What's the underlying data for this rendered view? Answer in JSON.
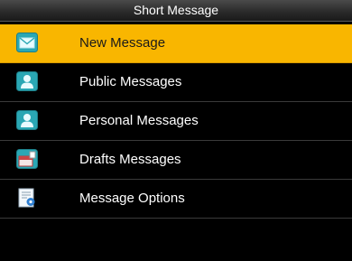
{
  "header": {
    "title": "Short Message"
  },
  "menu": {
    "items": [
      {
        "label": "New Message",
        "icon": "envelope-icon",
        "selected": true
      },
      {
        "label": "Public Messages",
        "icon": "user-icon",
        "selected": false
      },
      {
        "label": "Personal Messages",
        "icon": "user-icon",
        "selected": false
      },
      {
        "label": "Drafts Messages",
        "icon": "drafts-box-icon",
        "selected": false
      },
      {
        "label": "Message Options",
        "icon": "settings-document-icon",
        "selected": false
      }
    ]
  },
  "colors": {
    "selection": "#f9b600",
    "background": "#000000",
    "icon_teal": "#2aa7b4"
  }
}
